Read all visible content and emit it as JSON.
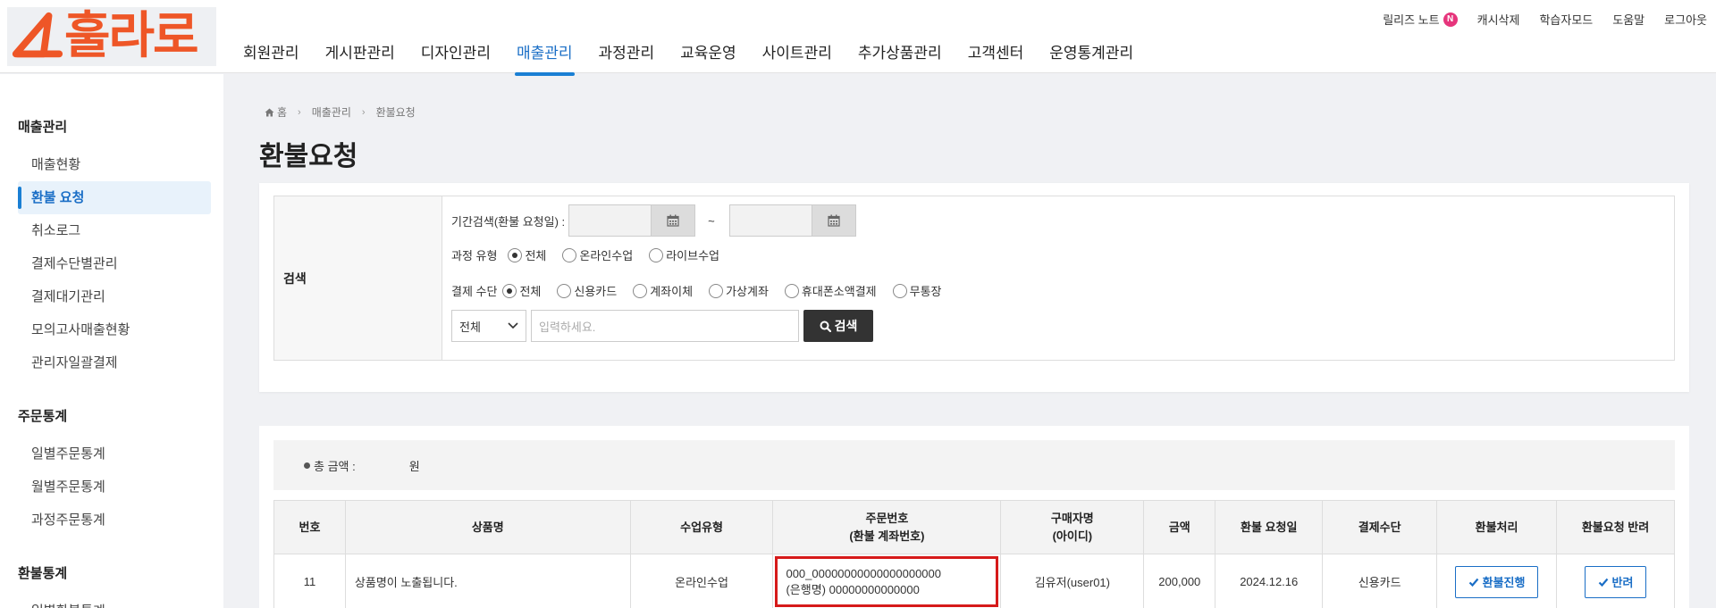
{
  "brand": {
    "name": "훌라로",
    "accent": "#ee5627"
  },
  "nav": {
    "items": [
      "회원관리",
      "게시판관리",
      "디자인관리",
      "매출관리",
      "과정관리",
      "교육운영",
      "사이트관리",
      "추가상품관리",
      "고객센터",
      "운영통계관리"
    ],
    "active": "매출관리"
  },
  "util": {
    "release_notes": "릴리즈 노트",
    "release_badge": "N",
    "cache_delete": "캐시삭제",
    "learner_mode": "학습자모드",
    "help": "도움말",
    "logout": "로그아웃"
  },
  "sidebar": {
    "groups": [
      {
        "title": "매출관리",
        "items": [
          "매출현황",
          "환불 요청",
          "취소로그",
          "결제수단별관리",
          "결제대기관리",
          "모의고사매출현황",
          "관리자일괄결제"
        ]
      },
      {
        "title": "주문통계",
        "items": [
          "일별주문통계",
          "월별주문통계",
          "과정주문통계"
        ]
      },
      {
        "title": "환불통계",
        "items": [
          "일별환불통계"
        ]
      }
    ],
    "active": "환불 요청"
  },
  "breadcrumb": {
    "home": "홈",
    "level1": "매출관리",
    "level2": "환불요청"
  },
  "page_title": "환불요청",
  "search": {
    "label": "검색",
    "period_label": "기간검색(환불 요청일) :",
    "tilde": "~",
    "course_type_label": "과정 유형",
    "course_types": [
      "전체",
      "온라인수업",
      "라이브수업"
    ],
    "course_type_selected": "전체",
    "payment_label": "결제 수단",
    "payment_methods": [
      "전체",
      "신용카드",
      "계좌이체",
      "가상계좌",
      "휴대폰소액결제",
      "무통장"
    ],
    "payment_selected": "전체",
    "select_value": "전체",
    "keyword_placeholder": "입력하세요.",
    "search_button": "검색"
  },
  "summary": {
    "total_label": "총 금액 :",
    "unit": "원"
  },
  "table": {
    "headers": {
      "no": "번호",
      "product": "상품명",
      "class_type": "수업유형",
      "order_line1": "주문번호",
      "order_line2": "(환불 계좌번호)",
      "buyer_line1": "구매자명",
      "buyer_line2": "(아이디)",
      "amount": "금액",
      "request_date": "환불 요청일",
      "payment": "결제수단",
      "process": "환불처리",
      "reject": "환불요청 반려"
    },
    "rows": [
      {
        "no": "11",
        "product": "상품명이 노출됩니다.",
        "class_type": "온라인수업",
        "order_no": "000_00000000000000000000",
        "refund_account": "(은행명) 00000000000000",
        "buyer": "김유저(user01)",
        "amount": "200,000",
        "request_date": "2024.12.16",
        "payment": "신용카드",
        "process_btn": "환불진행",
        "reject_btn": "반려"
      }
    ]
  }
}
